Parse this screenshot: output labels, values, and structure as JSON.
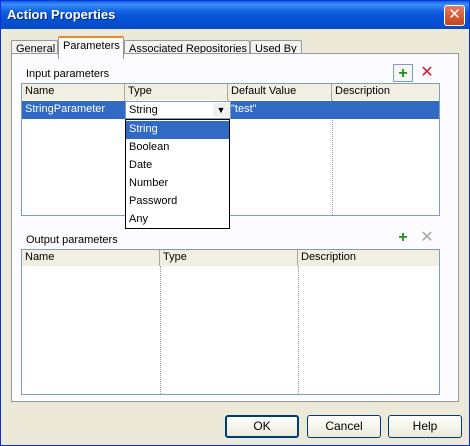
{
  "window": {
    "title": "Action Properties",
    "close_glyph": "✕"
  },
  "tabs": [
    {
      "label": "General"
    },
    {
      "label": "Parameters"
    },
    {
      "label": "Associated Repositories"
    },
    {
      "label": "Used By"
    }
  ],
  "active_tab": "Parameters",
  "input_params": {
    "label": "Input parameters",
    "columns": [
      "Name",
      "Type",
      "Default Value",
      "Description"
    ],
    "rows": [
      {
        "name": "StringParameter",
        "type": "String",
        "default": "\"test\"",
        "description": ""
      }
    ],
    "add_icon": "add-icon",
    "delete_icon": "delete-icon"
  },
  "type_dropdown": {
    "selected": "String",
    "options": [
      "String",
      "Boolean",
      "Date",
      "Number",
      "Password",
      "Any"
    ]
  },
  "output_params": {
    "label": "Output parameters",
    "columns": [
      "Name",
      "Type",
      "Description"
    ],
    "rows": [],
    "add_icon": "add-icon",
    "delete_icon": "delete-icon"
  },
  "buttons": {
    "ok": "OK",
    "cancel": "Cancel",
    "help": "Help"
  },
  "colors": {
    "title_bar": "#0a5fe8",
    "selection": "#316ac5",
    "add_green": "#179117",
    "delete_red": "#d11a2a"
  }
}
